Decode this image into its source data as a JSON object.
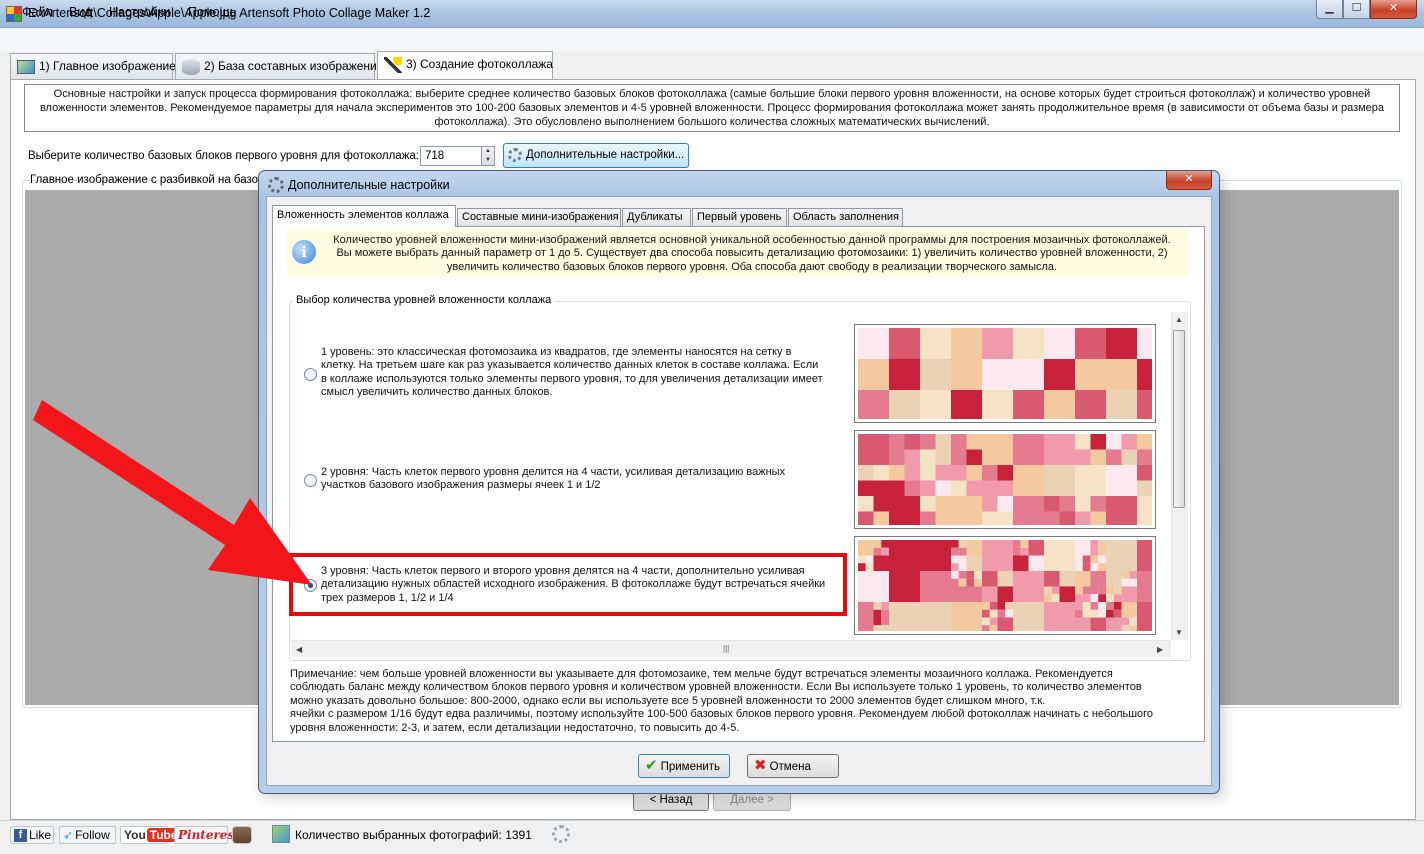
{
  "window": {
    "title": "E:\\Artensoft\\Collages\\Apple\\Apple.jpg Artensoft Photo Collage Maker 1.2",
    "minimize": "▁",
    "maximize": "☐",
    "close": "✕"
  },
  "menu": [
    "Файл",
    "Вид",
    "Настройки",
    "Помощь"
  ],
  "main_tabs": [
    {
      "label": "1) Главное изображение"
    },
    {
      "label": "2) База составных изображений"
    },
    {
      "label": "3) Создание фотоколлажа"
    }
  ],
  "info_box": "Основные настройки и запуск процесса формирования фотоколлажа: выберите среднее количество базовых блоков фотоколлажа (самые большие блоки первого уровня вложенности, на основе которых будет строиться фотоколлаж) и количество уровней вложенности элементов. Рекомендуемое параметры для начала экспериментов это 100-200 базовых элементов и 4-5 уровней вложенности.  Процесс формирования фотоколлажа может занять продолжительное время (в зависимости от объема базы и размера фотоколлажа). Это обусловлено выполнением большого количества сложных математических вычислений.",
  "blocks": {
    "label": "Выберите количество базовых блоков первого уровня для фотоколлажа:",
    "value": "718"
  },
  "advanced_button": "Дополнительные настройки...",
  "preview_label": "Главное изображение с разбивкой на базов",
  "nav": {
    "back": "< Назад",
    "next": "Далее >"
  },
  "status": {
    "facebook": "Like",
    "twitter": "Follow",
    "youtube_you": "You",
    "youtube_tube": "Tube",
    "pinterest": "Pinterest",
    "photo_count": "Количество выбранных фотографий: 1391"
  },
  "dialog": {
    "title": "Дополнительные настройки",
    "close": "✕",
    "tabs": [
      "Вложенность элементов коллажа",
      "Составные мини-изображения",
      "Дубликаты",
      "Первый уровень",
      "Область заполнения"
    ],
    "info_lines": [
      "Количество уровней вложенности мини-изображений является основной уникальной особенностью данной программы для построения мозаичных фотоколлажей.",
      "Вы можете выбрать данный параметр от 1 до 5. Существует два способа повысить детализацию фотомозаики: 1) увеличить количество уровней вложенности, 2)",
      "увеличить количество базовых блоков первого уровня. Оба способа дают свободу в реализации творческого замысла."
    ],
    "levels_legend": "Выбор количества уровней вложенности коллажа",
    "levels": [
      {
        "lines": [
          "1 уровень: это классическая фотомозаика из квадратов, где элементы наносятся на сетку в",
          "клетку. На третьем шаге как раз указывается количество данных клеток в составе коллажа. Если",
          "в коллаже используются только элементы первого уровня, то для увеличения детализации имеет",
          "смысл увеличить количество данных блоков."
        ],
        "checked": false
      },
      {
        "lines": [
          "2 уровня: Часть клеток первого уровня делится на 4 части, усиливая детализацию важных",
          "участков базового изображения размеры ячеек 1 и 1/2"
        ],
        "checked": false
      },
      {
        "lines": [
          "3 уровня: Часть клеток первого и второго уровня делятся на 4 части, дополнительно усиливая",
          "детализацию нужных областей исходного изображения. В фотоколлаже будут встречаться ячейки",
          "трех размеров 1, 1/2 и 1/4"
        ],
        "checked": true
      }
    ],
    "note_lines": [
      "Примечание: чем больше уровней вложенности вы указываете для фотомозаике, тем мельче будут встречаться элементы мозаичного коллажа. Рекомендуется",
      "соблюдать баланс между количеством блоков первого уровня и количеством уровней вложенности. Если Вы используете только 1 уровень, то количество элементов",
      "можно указать довольно большое: 800-2000, однако если вы используете все 5 уровней вложенности то 2000 элементов будет слишком много, т.к.",
      "ячейки с размером 1/16 будут едва различимы, поэтому используйте 100-500 базовых блоков первого уровня. Рекомендуем любой фотоколлаж начинать с небольшого",
      "уровня вложенности: 2-3, и затем, если детализации недостаточно, то повысить до 4-5."
    ],
    "apply": "Применить",
    "cancel": "Отмена"
  },
  "colors": {
    "highlight": "#e30b0b",
    "arrow": "#f2161b",
    "preview_bg": "#ababab",
    "rose_light": "#f6e3c6",
    "rose_pink": "#e57b8e",
    "rose_red": "#c8213b"
  }
}
